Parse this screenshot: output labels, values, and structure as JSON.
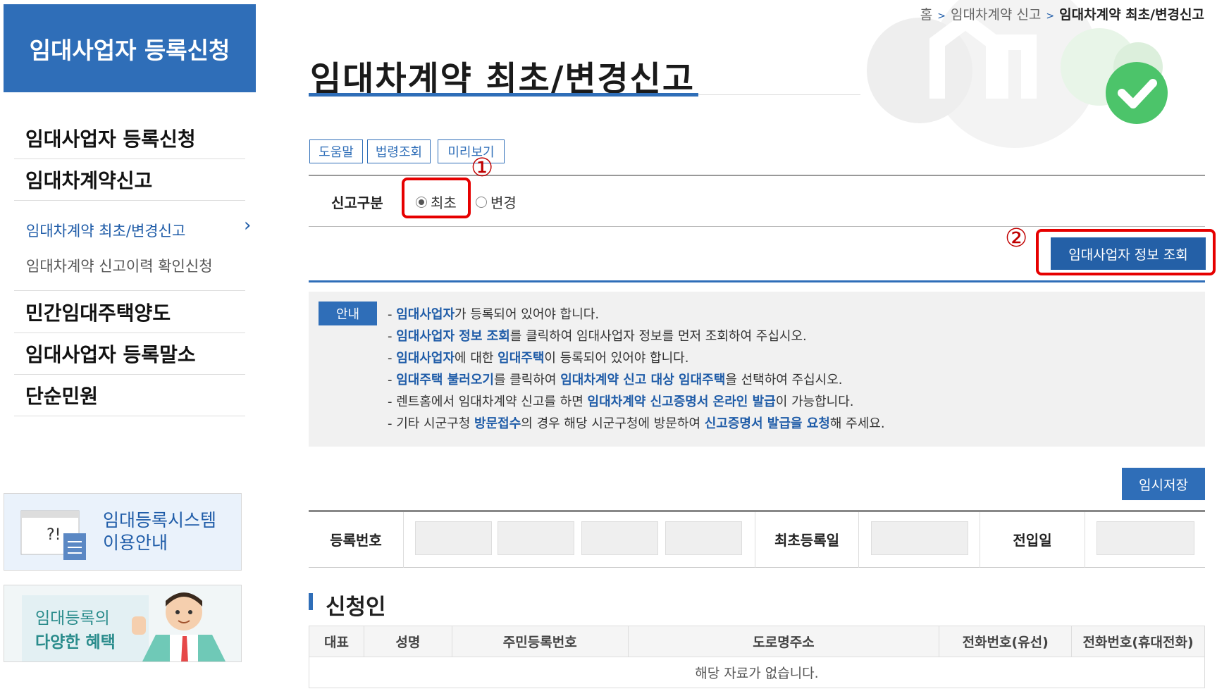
{
  "sidebar": {
    "header": "임대사업자 등록신청",
    "items": [
      {
        "label": "임대사업자 등록신청"
      },
      {
        "label": "임대차계약신고"
      },
      {
        "label": "민간임대주택양도"
      },
      {
        "label": "임대사업자 등록말소"
      },
      {
        "label": "단순민원"
      }
    ],
    "subitems": [
      {
        "label": "임대차계약 최초/변경신고",
        "active": true
      },
      {
        "label": "임대차계약 신고이력 확인신청",
        "active": false
      }
    ],
    "banner1": {
      "line1": "임대등록시스템",
      "line2": "이용안내"
    },
    "banner2": {
      "line1": "임대등록의",
      "line2": "다양한 혜택"
    }
  },
  "breadcrumb": {
    "home": "홈",
    "parent": "임대차계약 신고",
    "current": "임대차계약 최초/변경신고"
  },
  "page_title": "임대차계약 최초/변경신고",
  "toolbar": {
    "help": "도움말",
    "law": "법령조회",
    "preview": "미리보기"
  },
  "report": {
    "label": "신고구분",
    "options": [
      {
        "label": "최초",
        "selected": true
      },
      {
        "label": "변경",
        "selected": false
      }
    ]
  },
  "annotations": {
    "one": "①",
    "two": "②"
  },
  "lookup_button": "임대사업자 정보 조회",
  "notice": {
    "badge": "안내",
    "lines": [
      {
        "parts": [
          {
            "t": "- ",
            "h": false
          },
          {
            "t": "임대사업자",
            "h": true
          },
          {
            "t": "가 등록되어 있어야 합니다.",
            "h": false
          }
        ]
      },
      {
        "parts": [
          {
            "t": "- ",
            "h": false
          },
          {
            "t": "임대사업자 정보 조회",
            "h": true
          },
          {
            "t": "를 클릭하여 임대사업자 정보를 먼저 조회하여 주십시오.",
            "h": false
          }
        ]
      },
      {
        "parts": [
          {
            "t": "- ",
            "h": false
          },
          {
            "t": "임대사업자",
            "h": true
          },
          {
            "t": "에 대한 ",
            "h": false
          },
          {
            "t": "임대주택",
            "h": true
          },
          {
            "t": "이 등록되어 있어야 합니다.",
            "h": false
          }
        ]
      },
      {
        "parts": [
          {
            "t": "- ",
            "h": false
          },
          {
            "t": "임대주택 불러오기",
            "h": true
          },
          {
            "t": "를 클릭하여 ",
            "h": false
          },
          {
            "t": "임대차계약 신고 대상 임대주택",
            "h": true
          },
          {
            "t": "을 선택하여 주십시오.",
            "h": false
          }
        ]
      },
      {
        "parts": [
          {
            "t": "- 렌트홈에서 임대차계약 신고를 하면 ",
            "h": false
          },
          {
            "t": "임대차계약 신고증명서 온라인 발급",
            "h": true
          },
          {
            "t": "이 가능합니다.",
            "h": false
          }
        ]
      },
      {
        "parts": [
          {
            "t": "- 기타 시군구청 ",
            "h": false
          },
          {
            "t": "방문접수",
            "h": true
          },
          {
            "t": "의 경우 해당 시군구청에 방문하여 ",
            "h": false
          },
          {
            "t": "신고증명서 발급을 요청",
            "h": true
          },
          {
            "t": "해 주세요.",
            "h": false
          }
        ]
      }
    ]
  },
  "temp_save_button": "임시저장",
  "registration": {
    "reg_no_label": "등록번호",
    "first_reg_label": "최초등록일",
    "move_in_label": "전입일"
  },
  "applicant": {
    "title": "신청인",
    "columns": [
      "대표",
      "성명",
      "주민등록번호",
      "도로명주소",
      "전화번호(유선)",
      "전화번호(휴대전화)"
    ],
    "empty_message": "해당 자료가 없습니다."
  },
  "colors": {
    "primary": "#2f6eb8",
    "highlight_red": "#e60000"
  }
}
